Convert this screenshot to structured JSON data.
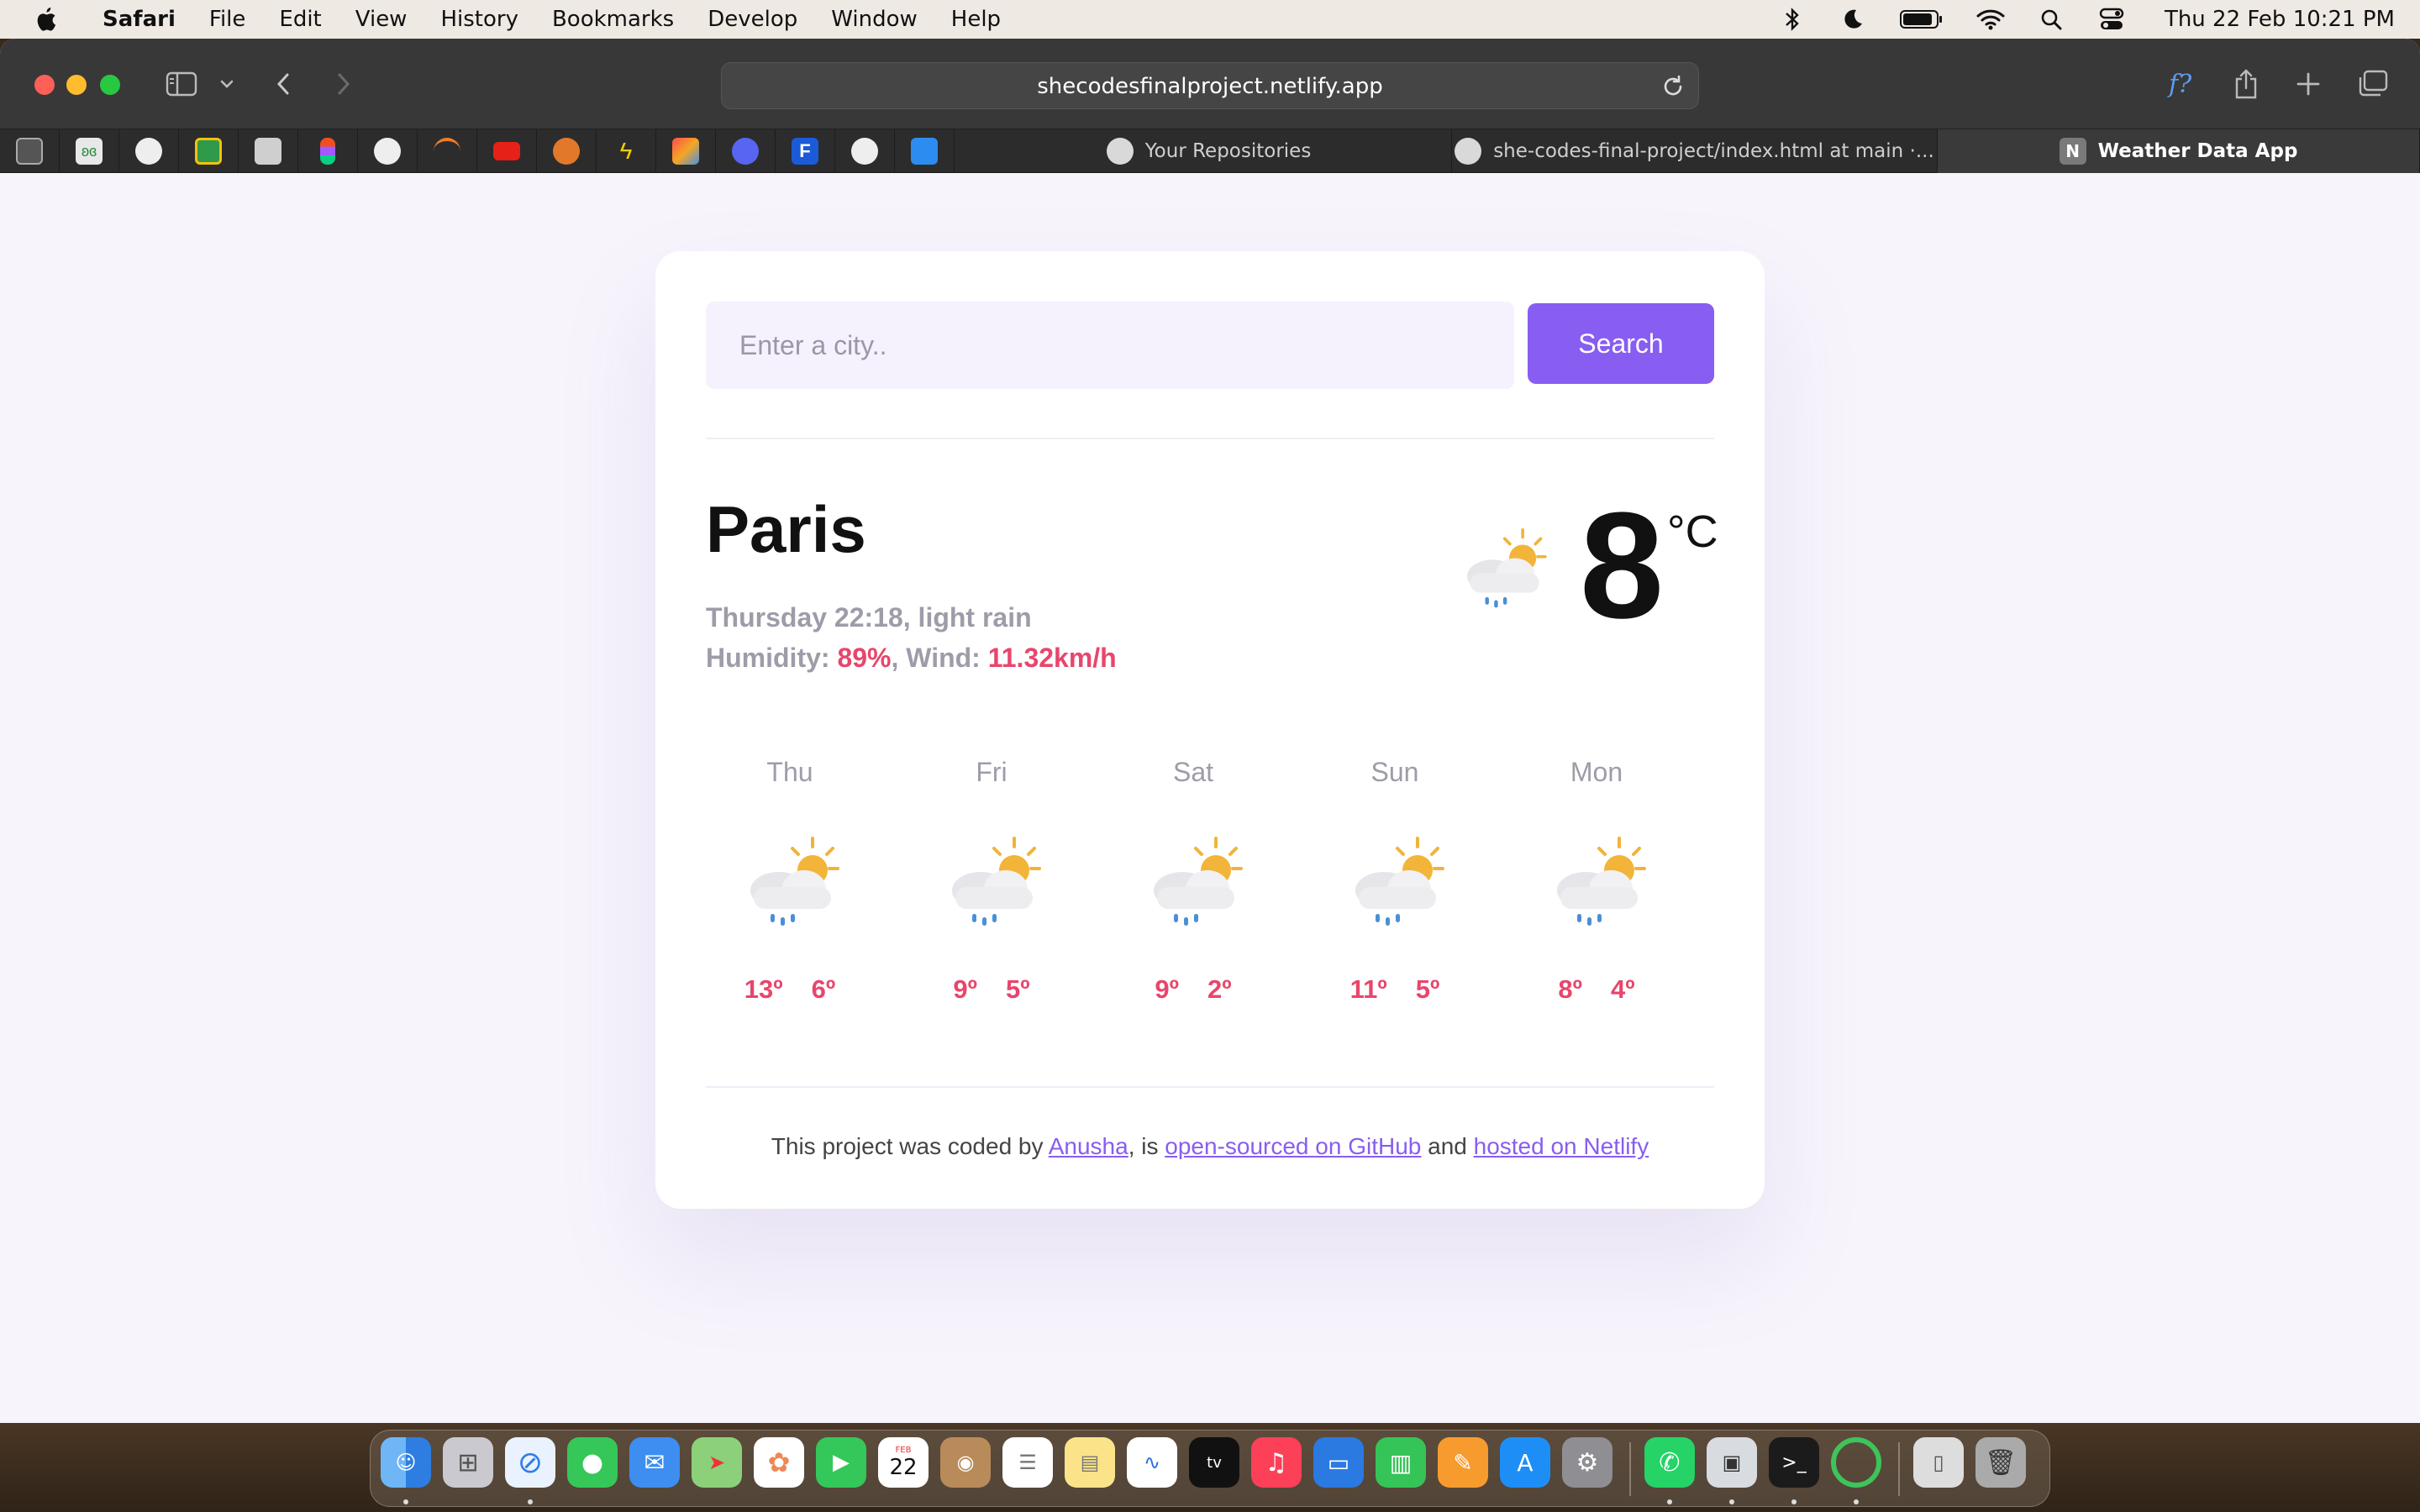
{
  "menubar": {
    "app_name": "Safari",
    "items": [
      "File",
      "Edit",
      "View",
      "History",
      "Bookmarks",
      "Develop",
      "Window",
      "Help"
    ],
    "clock": "Thu 22 Feb  10:21 PM"
  },
  "browser": {
    "url": "shecodesfinalproject.netlify.app",
    "tabs": [
      {
        "label": "Your Repositories"
      },
      {
        "label": "she-codes-final-project/index.html at main ·..."
      },
      {
        "label": "Weather Data App",
        "favicon_letter": "N"
      }
    ]
  },
  "app": {
    "search": {
      "placeholder": "Enter a city..",
      "button_label": "Search"
    },
    "current": {
      "city": "Paris",
      "datetime_desc": "Thursday 22:18, light rain",
      "humidity_label": "Humidity: ",
      "humidity": "89%",
      "wind_label": ", Wind: ",
      "wind": "11.32km/h",
      "temp": "8",
      "unit": "°C",
      "icon": "rain-cloud-sun-icon"
    },
    "forecast": [
      {
        "day": "Thu",
        "high": "13º",
        "low": "6º"
      },
      {
        "day": "Fri",
        "high": "9º",
        "low": "5º"
      },
      {
        "day": "Sat",
        "high": "9º",
        "low": "2º"
      },
      {
        "day": "Sun",
        "high": "11º",
        "low": "5º"
      },
      {
        "day": "Mon",
        "high": "8º",
        "low": "4º"
      }
    ],
    "footer": {
      "prefix": "This project was coded by ",
      "author_link": "Anusha",
      "mid": ", is ",
      "github_link": "open-sourced on GitHub",
      "and": " and ",
      "netlify_link": "hosted on Netlify"
    }
  },
  "colors": {
    "accent": "#885df1",
    "highlight": "#e8466c",
    "page_bg": "#f7f4fc"
  }
}
